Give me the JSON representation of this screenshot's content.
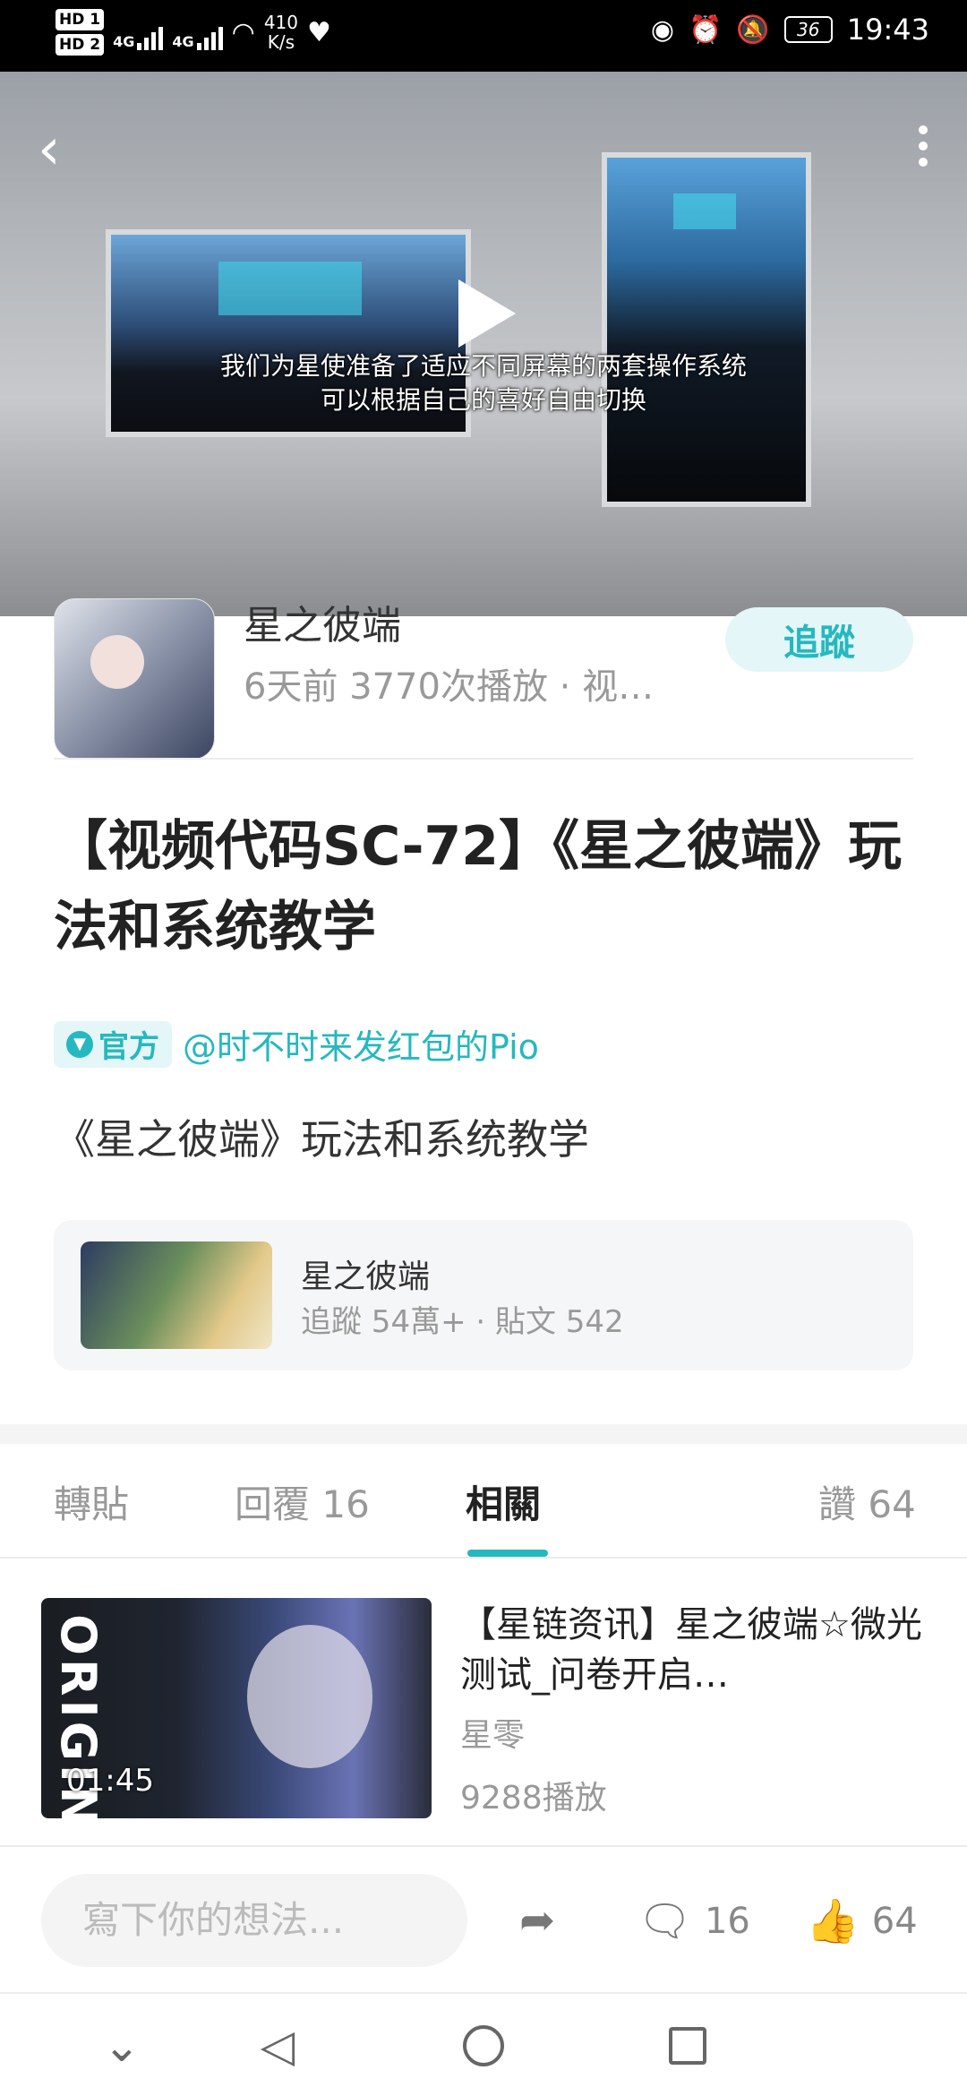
{
  "status_bar": {
    "hd1": "HD 1",
    "hd2": "HD 2",
    "signal1": "4G",
    "signal2": "4G",
    "net_speed_value": "410",
    "net_speed_unit": "K/s",
    "battery": "36",
    "time": "19:43"
  },
  "video": {
    "subtitle_line1": "我们为星使准备了适应不同屏幕的两套操作系统",
    "subtitle_line2": "可以根据自己的喜好自由切换"
  },
  "channel": {
    "name": "星之彼端",
    "meta": "6天前   3770次播放 · 视…",
    "follow_label": "追蹤"
  },
  "post": {
    "title": "【视频代码SC-72】《星之彼端》玩法和系统教学",
    "official_badge": "官方",
    "author": "@时不时来发红包的Pio",
    "description": "《星之彼端》玩法和系统教学"
  },
  "forum": {
    "name": "星之彼端",
    "stats": "追蹤 54萬+ · 貼文 542"
  },
  "tabs": [
    {
      "label": "轉貼"
    },
    {
      "label": "回覆 16"
    },
    {
      "label": "相關"
    },
    {
      "label": "讚 64"
    }
  ],
  "related": {
    "title": "【星链资讯】星之彼端☆微光测试_问卷开启…",
    "author": "星零",
    "plays": "9288播放",
    "duration": "01:45",
    "thumb_text": "ORIGIN"
  },
  "action_bar": {
    "placeholder": "寫下你的想法...",
    "comment_count": "16",
    "like_count": "64"
  },
  "colors": {
    "accent": "#25b8bf",
    "accent_bg": "#e4f6f7"
  }
}
